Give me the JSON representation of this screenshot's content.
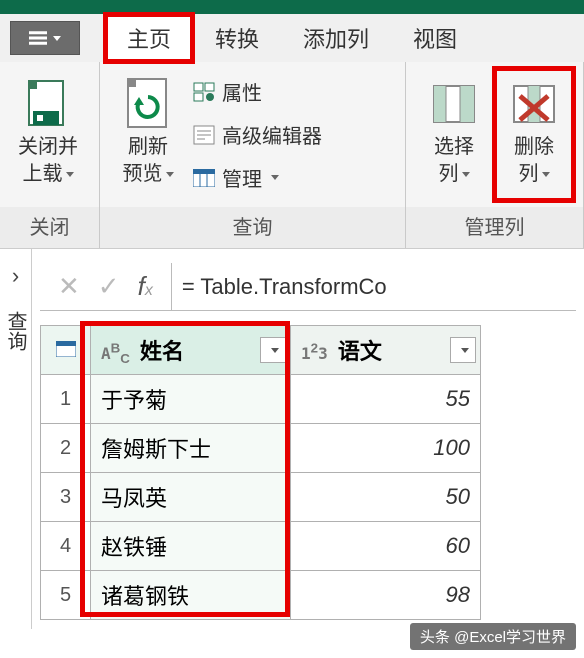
{
  "tabs": {
    "home": "主页",
    "transform": "转换",
    "addColumn": "添加列",
    "view": "视图"
  },
  "ribbon": {
    "closeLoad": {
      "label": "关闭并\n上载",
      "dropdown": true
    },
    "refresh": {
      "label": "刷新\n预览",
      "dropdown": true
    },
    "props": "属性",
    "advEditor": "高级编辑器",
    "manage": "管理",
    "selectCols": {
      "label": "选择\n列",
      "dropdown": true
    },
    "removeCols": {
      "label": "删除\n列",
      "dropdown": true
    },
    "groups": {
      "close": "关闭",
      "query": "查询",
      "manageCols": "管理列"
    }
  },
  "sidebar": {
    "expand": "›",
    "label": "查询"
  },
  "formula": "= Table.TransformCo",
  "grid": {
    "columns": [
      {
        "name": "姓名",
        "type": "ABC"
      },
      {
        "name": "语文",
        "type": "123"
      }
    ],
    "rows": [
      {
        "idx": "1",
        "name": "于予菊",
        "score": "55"
      },
      {
        "idx": "2",
        "name": "詹姆斯下士",
        "score": "100"
      },
      {
        "idx": "3",
        "name": "马凤英",
        "score": "50"
      },
      {
        "idx": "4",
        "name": "赵铁锤",
        "score": "60"
      },
      {
        "idx": "5",
        "name": "诸葛钢铁",
        "score": "98"
      }
    ]
  },
  "watermark": "头条 @Excel学习世界"
}
